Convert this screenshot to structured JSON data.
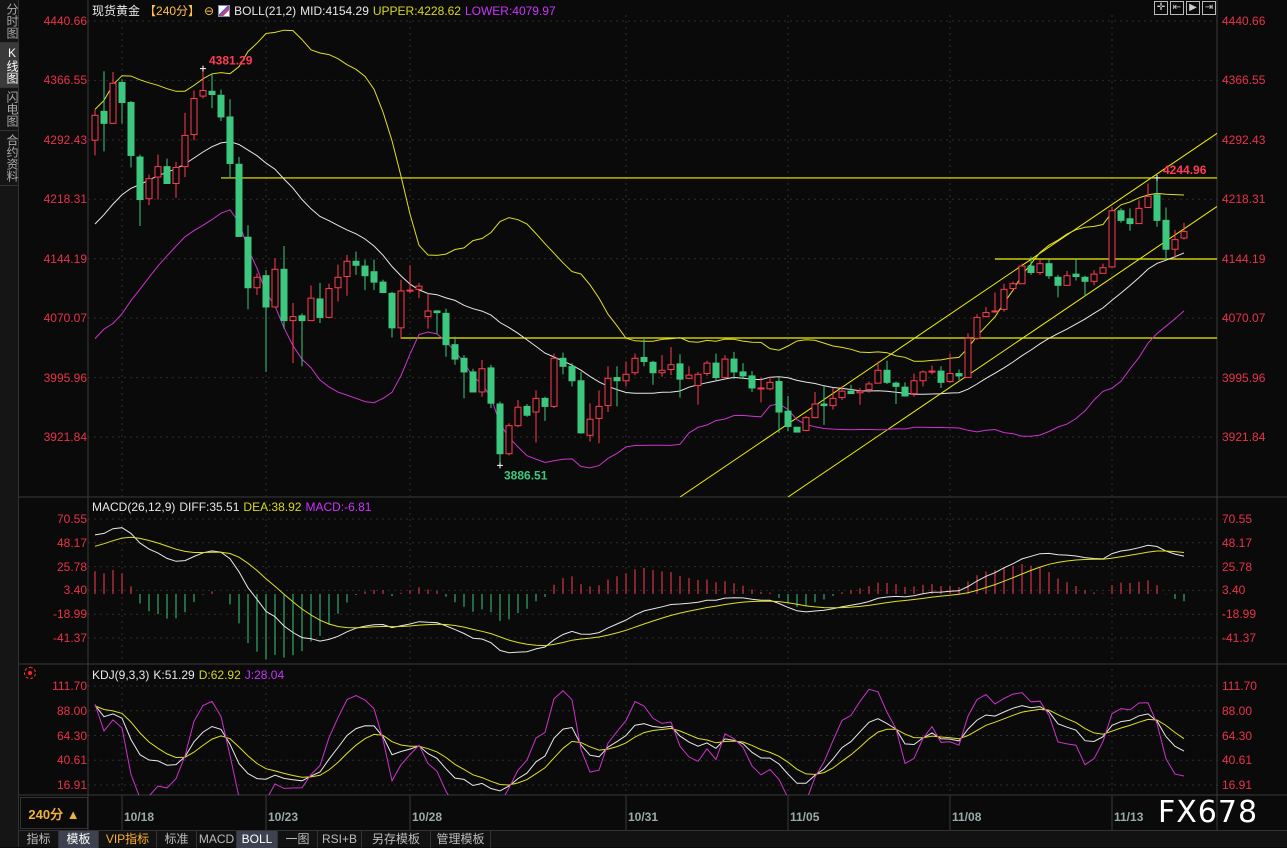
{
  "sidebar": {
    "tabs": [
      {
        "label": "分时图"
      },
      {
        "label": "K线图"
      },
      {
        "label": "闪电图"
      },
      {
        "label": "合约资料"
      }
    ],
    "active_index": 1
  },
  "header": {
    "symbol": "现货黄金",
    "period": "【240分】",
    "indicator": "BOLL(21,2)",
    "mid": "MID:4154.29",
    "upper": "UPPER:4228.62",
    "lower": "LOWER:4079.97"
  },
  "macd_header": {
    "name": "MACD(26,12,9)",
    "diff": "DIFF:35.51",
    "dea": "DEA:38.92",
    "macd": "MACD:-6.81"
  },
  "kdj_header": {
    "name": "KDJ(9,3,3)",
    "k": "K:51.29",
    "d": "D:62.92",
    "j": "J:28.04"
  },
  "top_icons": [
    "crosshair-icon",
    "zoom-left-icon",
    "play-right-icon",
    "move-right-icon"
  ],
  "period_button": "240分 ▲",
  "toolbar": [
    {
      "label": "指标"
    },
    {
      "label": "模板",
      "active": true
    },
    {
      "label": "VIP指标",
      "vip": true
    },
    {
      "label": "标准"
    },
    {
      "label": "MACD"
    },
    {
      "label": "BOLL",
      "active": true
    },
    {
      "label": "一图"
    },
    {
      "label": "RSI+B"
    },
    {
      "label": "另存模板"
    },
    {
      "label": "管理模板"
    }
  ],
  "watermark": "FX678",
  "colors": {
    "up": "#ff3b52",
    "down": "#3cc97f",
    "axis_text": "#e8334a",
    "mid": "#e8e8e8",
    "upper": "#e0e020",
    "lower": "#cc33cc",
    "drawing": "#f0f000"
  },
  "chart_data": {
    "type": "candlestick",
    "price_ticks": [
      "4440.66",
      "4366.55",
      "4292.43",
      "4218.31",
      "4144.19",
      "4070.07",
      "3995.96",
      "3921.84"
    ],
    "macd_ticks": [
      "70.55",
      "48.17",
      "25.78",
      "3.40",
      "-18.99",
      "-41.37"
    ],
    "kdj_ticks": [
      "111.70",
      "88.00",
      "64.30",
      "40.61",
      "16.91"
    ],
    "x_labels": [
      {
        "label": "10/18",
        "index": 3
      },
      {
        "label": "10/23",
        "index": 19
      },
      {
        "label": "10/28",
        "index": 35
      },
      {
        "label": "10/31",
        "index": 59
      },
      {
        "label": "11/05",
        "index": 77
      },
      {
        "label": "11/08",
        "index": 95
      },
      {
        "label": "11/13",
        "index": 113
      }
    ],
    "annotations": [
      {
        "text": "4381.29",
        "index": 12,
        "price": 4381.29,
        "kind": "high"
      },
      {
        "text": "3886.51",
        "index": 45,
        "price": 3886.51,
        "kind": "low"
      },
      {
        "text": "4244.96",
        "index": 118,
        "price": 4244.96,
        "kind": "high"
      }
    ],
    "drawings": {
      "hlines": [
        {
          "price": 4244.96,
          "from_index": 14
        },
        {
          "price": 4045.3,
          "from_index": 34
        },
        {
          "price": 4143.8,
          "from_index": 100
        }
      ],
      "channel": {
        "slope_per_bar": 7.6,
        "lines": [
          {
            "index": 65,
            "price": 3847
          },
          {
            "index": 77,
            "price": 3847
          }
        ]
      }
    },
    "candles": [
      [
        4292,
        4330,
        4273,
        4323
      ],
      [
        4328,
        4378,
        4278,
        4313
      ],
      [
        4313,
        4377,
        4313,
        4363
      ],
      [
        4364,
        4368,
        4313,
        4339
      ],
      [
        4339,
        4341,
        4258,
        4273
      ],
      [
        4271,
        4274,
        4185,
        4218
      ],
      [
        4219,
        4249,
        4211,
        4244
      ],
      [
        4246,
        4274,
        4218,
        4259
      ],
      [
        4259,
        4269,
        4238,
        4238
      ],
      [
        4238,
        4265,
        4220,
        4258
      ],
      [
        4259,
        4326,
        4246,
        4298
      ],
      [
        4299,
        4354,
        4292,
        4344
      ],
      [
        4347,
        4381.29,
        4344,
        4354
      ],
      [
        4353,
        4375,
        4332,
        4349
      ],
      [
        4348,
        4355,
        4316,
        4321
      ],
      [
        4321,
        4343,
        4244,
        4263
      ],
      [
        4262,
        4271,
        4172,
        4172
      ],
      [
        4171,
        4186,
        4081,
        4108
      ],
      [
        4108,
        4126,
        4099,
        4121
      ],
      [
        4123,
        4130,
        4003,
        4084
      ],
      [
        4084,
        4145,
        4084,
        4131
      ],
      [
        4131,
        4160,
        4057,
        4067
      ],
      [
        4067,
        4089,
        4014,
        4072
      ],
      [
        4073,
        4076,
        4010,
        4067
      ],
      [
        4067,
        4111,
        4067,
        4095
      ],
      [
        4094,
        4114,
        4064,
        4071
      ],
      [
        4071,
        4113,
        4071,
        4107
      ],
      [
        4108,
        4137,
        4091,
        4121
      ],
      [
        4122,
        4149,
        4098,
        4141
      ],
      [
        4141,
        4153,
        4124,
        4136
      ],
      [
        4135,
        4143,
        4105,
        4123
      ],
      [
        4128,
        4143,
        4105,
        4115
      ],
      [
        4115,
        4118,
        4102,
        4102
      ],
      [
        4101,
        4103,
        4046,
        4058
      ],
      [
        4058,
        4118,
        4044,
        4104
      ],
      [
        4104,
        4136,
        4101,
        4105
      ],
      [
        4106,
        4114,
        4095,
        4110
      ],
      [
        4072,
        4101,
        4057,
        4079
      ],
      [
        4079,
        4080,
        4051,
        4077
      ],
      [
        4076,
        4082,
        4022,
        4037
      ],
      [
        4037,
        4047,
        4012,
        4019
      ],
      [
        4020,
        4024,
        3970,
        4003
      ],
      [
        4003,
        4007,
        3978,
        3978
      ],
      [
        3978,
        4018,
        3972,
        4007
      ],
      [
        4008,
        4012,
        3958,
        3964
      ],
      [
        3963,
        3966,
        3886.51,
        3901
      ],
      [
        3901,
        3939,
        3899,
        3936
      ],
      [
        3936,
        3968,
        3934,
        3959
      ],
      [
        3960,
        3963,
        3947,
        3949
      ],
      [
        3953,
        3980,
        3915,
        3970
      ],
      [
        3970,
        3972,
        3942,
        3960
      ],
      [
        3960,
        4026,
        3958,
        4020
      ],
      [
        4020,
        4027,
        4000,
        4010
      ],
      [
        4010,
        4014,
        3985,
        3992
      ],
      [
        3992,
        4003,
        3926,
        3927
      ],
      [
        3924,
        3964,
        3916,
        3944
      ],
      [
        3945,
        3980,
        3914,
        3960
      ],
      [
        3961,
        4010,
        3953,
        3995
      ],
      [
        3996,
        4010,
        3960,
        3992
      ],
      [
        3992,
        4016,
        3985,
        4000
      ],
      [
        4002,
        4026,
        3999,
        4020
      ],
      [
        4021,
        4044,
        4010,
        4016
      ],
      [
        4015,
        4017,
        3987,
        4002
      ],
      [
        4002,
        4024,
        3997,
        4005
      ],
      [
        4006,
        4034,
        3999,
        4012
      ],
      [
        4013,
        4025,
        3971,
        3994
      ],
      [
        3995,
        4010,
        3994,
        3999
      ],
      [
        3986,
        4003,
        3962,
        4000
      ],
      [
        4001,
        4017,
        3998,
        4014
      ],
      [
        4014,
        4026,
        3993,
        3996
      ],
      [
        3996,
        4024,
        3994,
        4019
      ],
      [
        4019,
        4028,
        3994,
        4003
      ],
      [
        4003,
        4014,
        3994,
        3998
      ],
      [
        3998,
        4004,
        3978,
        3983
      ],
      [
        3983,
        3996,
        3965,
        3983
      ],
      [
        3982,
        3997,
        3980,
        3990
      ],
      [
        3991,
        3997,
        3927,
        3953
      ],
      [
        3954,
        3973,
        3929,
        3935
      ],
      [
        3934,
        3934,
        3928,
        3928
      ],
      [
        3930,
        3948,
        3929,
        3946
      ],
      [
        3946,
        3978,
        3946,
        3963
      ],
      [
        3963,
        3985,
        3937,
        3961
      ],
      [
        3961,
        3983,
        3956,
        3970
      ],
      [
        3971,
        3985,
        3968,
        3979
      ],
      [
        3979,
        3987,
        3976,
        3976
      ],
      [
        3977,
        3983,
        3962,
        3979
      ],
      [
        3981,
        3991,
        3977,
        3988
      ],
      [
        3989,
        4016,
        3989,
        4005
      ],
      [
        4005,
        4017,
        3988,
        3990
      ],
      [
        3989,
        3991,
        3963,
        3985
      ],
      [
        3984,
        3990,
        3973,
        3973
      ],
      [
        3976,
        4001,
        3972,
        3992
      ],
      [
        3992,
        4005,
        3985,
        4003
      ],
      [
        4003,
        4011,
        4000,
        4004
      ],
      [
        4004,
        4010,
        3983,
        3990
      ],
      [
        3991,
        4026,
        3989,
        4001
      ],
      [
        4001,
        4006,
        3993,
        3998
      ],
      [
        3996,
        4051,
        3996,
        4045
      ],
      [
        4045,
        4075,
        4043,
        4071
      ],
      [
        4072,
        4084,
        4071,
        4077
      ],
      [
        4078,
        4102,
        4077,
        4079
      ],
      [
        4081,
        4113,
        4078,
        4106
      ],
      [
        4107,
        4116,
        4107,
        4113
      ],
      [
        4113,
        4138,
        4113,
        4135
      ],
      [
        4135,
        4147,
        4124,
        4127
      ],
      [
        4127,
        4143,
        4124,
        4138
      ],
      [
        4138,
        4143,
        4119,
        4123
      ],
      [
        4121,
        4124,
        4096,
        4111
      ],
      [
        4111,
        4129,
        4111,
        4123
      ],
      [
        4125,
        4143,
        4117,
        4122
      ],
      [
        4121,
        4123,
        4097,
        4116
      ],
      [
        4116,
        4130,
        4111,
        4125
      ],
      [
        4126,
        4138,
        4126,
        4133
      ],
      [
        4134,
        4209,
        4133,
        4204
      ],
      [
        4204,
        4207,
        4189,
        4192
      ],
      [
        4194,
        4207,
        4179,
        4188
      ],
      [
        4188,
        4217,
        4188,
        4207
      ],
      [
        4208,
        4238,
        4208,
        4222
      ],
      [
        4224,
        4244.96,
        4184,
        4192
      ],
      [
        4192,
        4208,
        4143,
        4156
      ],
      [
        4156,
        4180,
        4145,
        4168
      ],
      [
        4170,
        4189,
        4168,
        4178
      ]
    ]
  }
}
